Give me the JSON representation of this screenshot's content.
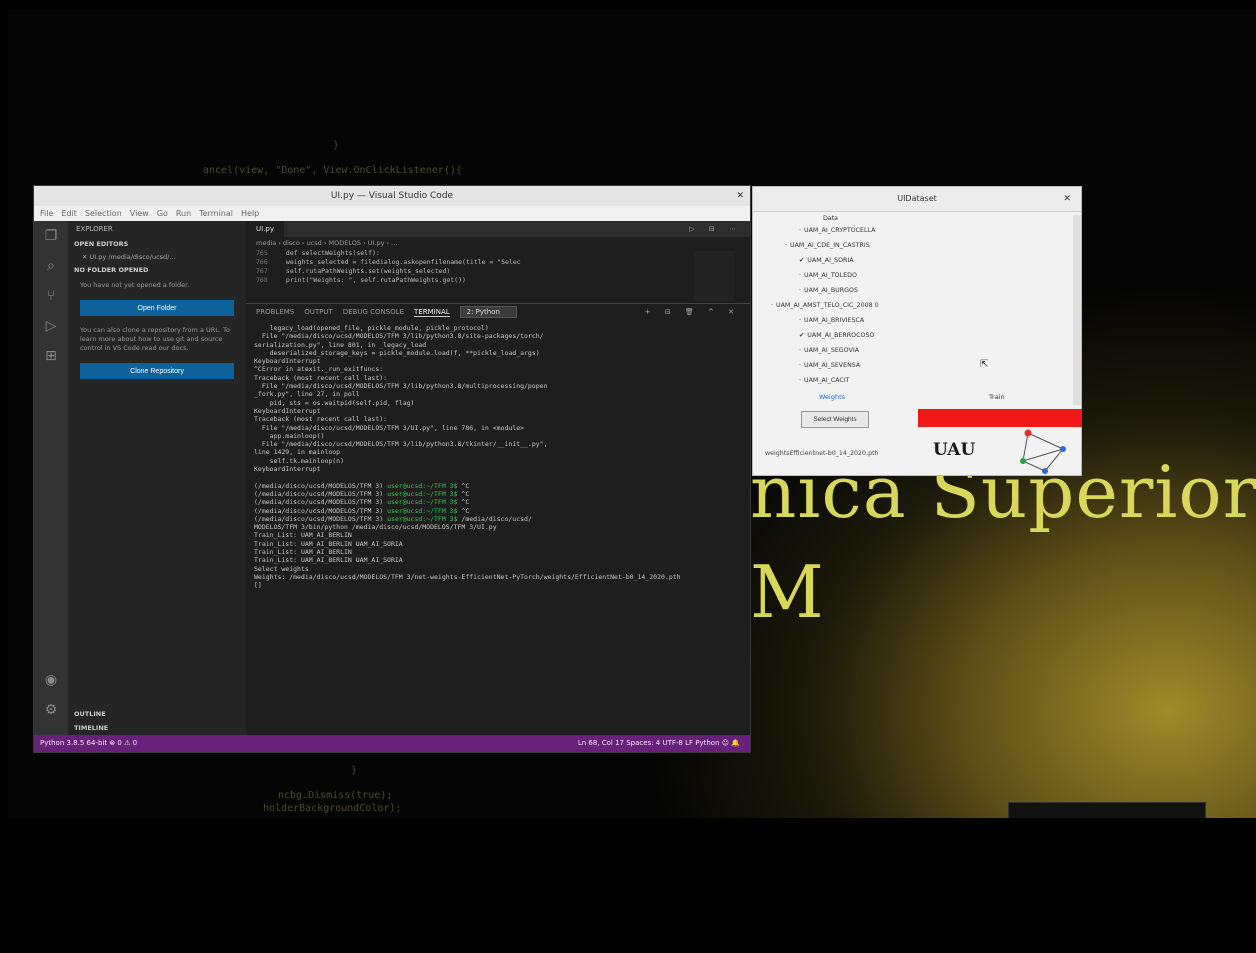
{
  "background": {
    "big_text_line1": "nica Superior",
    "big_text_line2": "M",
    "faint_code": [
      "}",
      "ancel(view, \"Done\", View.OnClickListener(){",
      "   }",
      "   ",
      "ncbg.Dismiss(true);",
      "holderBackgroundColor);"
    ]
  },
  "vscode": {
    "title": "UI.py — Visual Studio Code",
    "menu": [
      "File",
      "Edit",
      "Selection",
      "View",
      "Go",
      "Run",
      "Terminal",
      "Help"
    ],
    "activity_icons": [
      "files-icon",
      "search-icon",
      "source-control-icon",
      "run-debug-icon",
      "extensions-icon"
    ],
    "sidebar": {
      "title": "EXPLORER",
      "open_editors": "OPEN EDITORS",
      "open_file": "✕ UI.py /media/disco/ucsd/...",
      "no_folder": "NO FOLDER OPENED",
      "msg1": "You have not yet opened a folder.",
      "open_folder_btn": "Open Folder",
      "msg2": "You can also clone a repository from a URL. To learn more about how to use git and source control in VS Code read our docs.",
      "clone_btn": "Clone Repository",
      "outline": "OUTLINE",
      "timeline": "TIMELINE"
    },
    "editor": {
      "tab": "UI.py",
      "breadcrumb": "media › disco › ucsd › MODELOS › UI.py › ...",
      "code": [
        {
          "ln": "765",
          "text": "    def selectWeights(self):"
        },
        {
          "ln": "766",
          "text": "        weights_selected = filedialog.askopenfilename(title = \"Selec"
        },
        {
          "ln": "767",
          "text": "        self.rutaPathWeights.set(weights_selected)"
        },
        {
          "ln": "768",
          "text": "        print(\"Weights: \", self.rutaPathWeights.get())"
        }
      ]
    },
    "panel": {
      "tabs": [
        "PROBLEMS",
        "OUTPUT",
        "DEBUG CONSOLE",
        "TERMINAL"
      ],
      "active_tab": "TERMINAL",
      "terminal_select": "2: Python"
    },
    "terminal": [
      "    legacy_load(opened_file, pickle_module, pickle_protocol)",
      "  File \"/media/disco/ucsd/MODELOS/TFM 3/lib/python3.8/site-packages/torch/",
      "serialization.py\", line 801, in _legacy_load",
      "    deserialized_storage_keys = pickle_module.load(f, **pickle_load_args)",
      "KeyboardInterrupt",
      "^CError in atexit._run_exitfuncs:",
      "Traceback (most recent call last):",
      "  File \"/media/disco/ucsd/MODELOS/TFM 3/lib/python3.8/multiprocessing/popen",
      "_fork.py\", line 27, in poll",
      "    pid, sts = os.waitpid(self.pid, flag)",
      "KeyboardInterrupt",
      "Traceback (most recent call last):",
      "  File \"/media/disco/ucsd/MODELOS/TFM 3/UI.py\", line 786, in <module>",
      "    app.mainloop()",
      "  File \"/media/disco/ucsd/MODELOS/TFM 3/lib/python3.8/tkinter/__init__.py\",",
      "line 1429, in mainloop",
      "    self.tk.mainloop(n)",
      "KeyboardInterrupt"
    ],
    "terminal_prompts": [
      {
        "path": "(/media/disco/ucsd/MODELOS/TFM 3) ",
        "user": "user@ucsd:~/TFM 3$",
        "tail": " ^C"
      },
      {
        "path": "(/media/disco/ucsd/MODELOS/TFM 3) ",
        "user": "user@ucsd:~/TFM 3$",
        "tail": " ^C"
      },
      {
        "path": "(/media/disco/ucsd/MODELOS/TFM 3) ",
        "user": "user@ucsd:~/TFM 3$",
        "tail": " ^C"
      },
      {
        "path": "(/media/disco/ucsd/MODELOS/TFM 3) ",
        "user": "user@ucsd:~/TFM 3$",
        "tail": " ^C"
      },
      {
        "path": "(/media/disco/ucsd/MODELOS/TFM 3) ",
        "user": "user@ucsd:~/TFM 3$",
        "tail": " /media/disco/ucsd/"
      }
    ],
    "terminal_tail": [
      "MODELOS/TFM 3/bin/python /media/disco/ucsd/MODELOS/TFM 3/UI.py",
      "Train_List: UAM_AI_BERLIN",
      "Train_List: UAM_AI_BERLIN UAM_AI_SORIA",
      "Train_List: UAM_AI_BERLIN",
      "Train_List: UAM_AI_BERLIN UAM_AI_SORIA",
      "Select weights",
      "Weights: /media/disco/ucsd/MODELOS/TFM 3/net-weights-EfficientNet-PyTorch/weights/EfficientNet-b0_14_2020.pth",
      "[]"
    ],
    "status_left": "Python 3.8.5 64-bit    ⊗ 0  ⚠ 0",
    "status_right": "Ln 68, Col 17   Spaces: 4   UTF-8   LF   Python   ☺   🔔"
  },
  "dialog": {
    "title": "UIDataset",
    "tree_root": "Data",
    "items": [
      {
        "label": "UAM_AI_CRYPTOCELLA",
        "checked": false,
        "indent": 2
      },
      {
        "label": "UAM_AI_CDE_IN_CASTRIS",
        "checked": false,
        "indent": 1
      },
      {
        "label": "UAM_AI_SORIA",
        "checked": true,
        "indent": 2
      },
      {
        "label": "UAM_AI_TOLEDO",
        "checked": false,
        "indent": 2
      },
      {
        "label": "UAM_AI_BURGOS",
        "checked": false,
        "indent": 2
      },
      {
        "label": "UAM_AI_AMST_TELO_CIC_2008 0",
        "checked": false,
        "indent": 0
      },
      {
        "label": "UAM_AI_BRIVIESCA",
        "checked": false,
        "indent": 2
      },
      {
        "label": "UAM_AI_BERROCOSO",
        "checked": true,
        "indent": 2
      },
      {
        "label": "UAM_AI_SEGOVIA",
        "checked": false,
        "indent": 2
      },
      {
        "label": "UAM_AI_SEVENSA",
        "checked": false,
        "indent": 2
      },
      {
        "label": "UAM_AI_CACIT",
        "checked": false,
        "indent": 2
      }
    ],
    "weights_label": "Weights",
    "run_label": "Train",
    "select_button": "Select Weights",
    "weights_file": "weightsEfficientnet-b0_14_2020.pth",
    "logo_text": "UAU",
    "accent_red": "#f21818"
  }
}
